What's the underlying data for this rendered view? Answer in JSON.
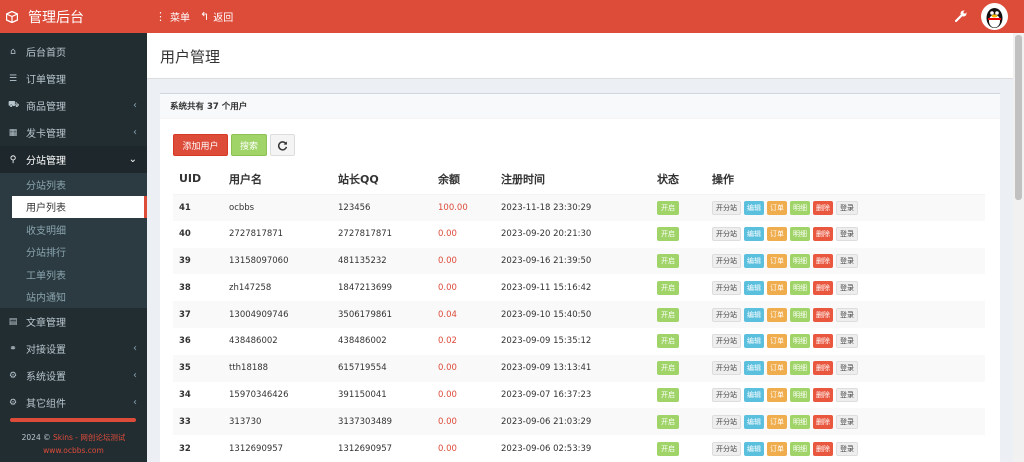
{
  "app": {
    "title": "管理后台",
    "menu_label": "菜单",
    "back_label": "返回"
  },
  "sidebar": {
    "items": [
      {
        "label": "后台首页",
        "icon": "home-icon",
        "has_arrow": false
      },
      {
        "label": "订单管理",
        "icon": "list-icon",
        "has_arrow": false
      },
      {
        "label": "商品管理",
        "icon": "cart-icon",
        "has_arrow": true
      },
      {
        "label": "发卡管理",
        "icon": "grid-icon",
        "has_arrow": true
      },
      {
        "label": "分站管理",
        "icon": "sitemap-icon",
        "has_arrow": true,
        "active": true
      },
      {
        "label": "文章管理",
        "icon": "article-icon",
        "has_arrow": false
      },
      {
        "label": "对接设置",
        "icon": "link-icon",
        "has_arrow": true
      },
      {
        "label": "系统设置",
        "icon": "gear-icon",
        "has_arrow": true
      },
      {
        "label": "其它组件",
        "icon": "cogs-icon",
        "has_arrow": true
      }
    ],
    "submenu": [
      "分站列表",
      "用户列表",
      "收支明细",
      "分站排行",
      "工单列表",
      "站内通知"
    ],
    "submenu_active": 1,
    "footer_year": "2024 ©",
    "footer_link": "Skins - 网创论坛测试",
    "footer_site": "www.ocbbs.com"
  },
  "page": {
    "title": "用户管理",
    "box_title": "系统共有 37 个用户",
    "add_button": "添加用户",
    "search_button": "搜索"
  },
  "table": {
    "headers": [
      "UID",
      "用户名",
      "站长QQ",
      "余额",
      "注册时间",
      "状态",
      "操作"
    ],
    "status_label": "开启",
    "actions": [
      "开分站",
      "编辑",
      "订单",
      "明细",
      "删除",
      "登录"
    ],
    "rows": [
      [
        "41",
        "ocbbs",
        "123456",
        "100.00",
        "2023-11-18 23:30:29"
      ],
      [
        "40",
        "2727817871",
        "2727817871",
        "0.00",
        "2023-09-20 20:21:30"
      ],
      [
        "39",
        "13158097060",
        "481135232",
        "0.00",
        "2023-09-16 21:39:50"
      ],
      [
        "38",
        "zh147258",
        "1847213699",
        "0.00",
        "2023-09-11 15:16:42"
      ],
      [
        "37",
        "13004909746",
        "3506179861",
        "0.04",
        "2023-09-10 15:40:50"
      ],
      [
        "36",
        "438486002",
        "438486002",
        "0.02",
        "2023-09-09 15:35:12"
      ],
      [
        "35",
        "tth18188",
        "615719554",
        "0.00",
        "2023-09-09 13:13:41"
      ],
      [
        "34",
        "15970346426",
        "391150041",
        "0.00",
        "2023-09-07 16:37:23"
      ],
      [
        "33",
        "313730",
        "3137303489",
        "0.00",
        "2023-09-06 21:03:29"
      ],
      [
        "32",
        "1312690957",
        "1312690957",
        "0.00",
        "2023-09-06 02:53:39"
      ]
    ]
  },
  "colors": {
    "accent": "#dd4b39",
    "sidebar": "#222d32",
    "success": "#a0d468",
    "info": "#5bc0de",
    "warning": "#f0ad4e"
  }
}
